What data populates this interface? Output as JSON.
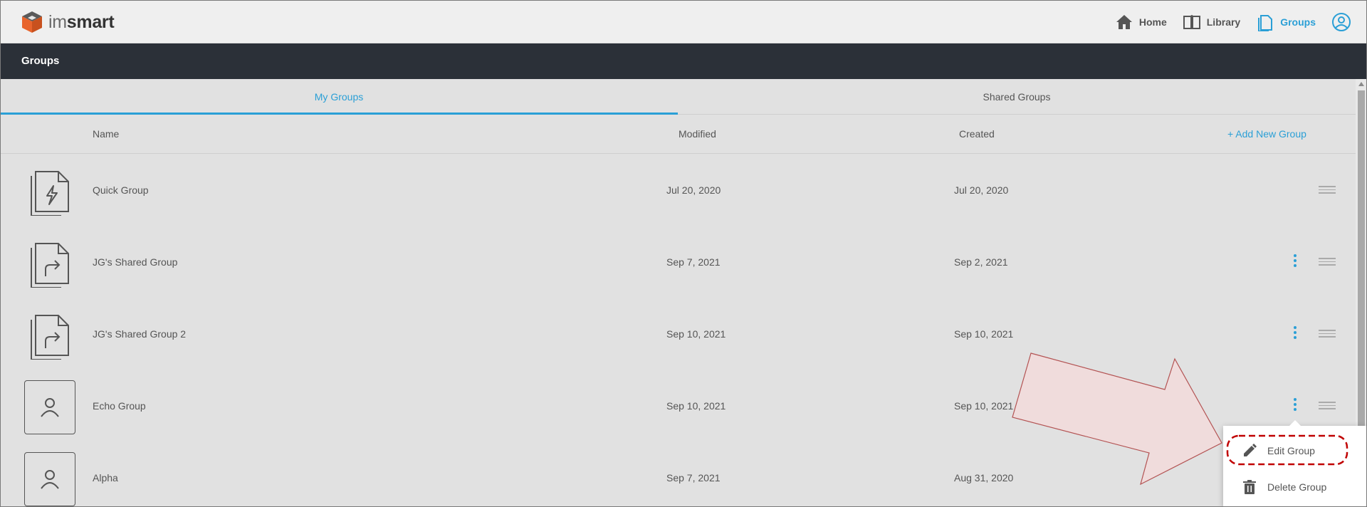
{
  "app": {
    "logo_text_light": "im",
    "logo_text_bold": "smart"
  },
  "nav": {
    "home": "Home",
    "library": "Library",
    "groups": "Groups",
    "user_icon": "user-circle-icon"
  },
  "page": {
    "title": "Groups"
  },
  "tabs": [
    {
      "label": "My Groups",
      "active": true
    },
    {
      "label": "Shared Groups",
      "active": false
    }
  ],
  "columns": {
    "name": "Name",
    "modified": "Modified",
    "created": "Created",
    "add_new": "+ Add New Group"
  },
  "groups": [
    {
      "name": "Quick Group",
      "modified": "Jul 20, 2020",
      "created": "Jul 20, 2020",
      "icon": "quick-group-icon",
      "has_menu": false
    },
    {
      "name": "JG's Shared Group",
      "modified": "Sep 7, 2021",
      "created": "Sep 2, 2021",
      "icon": "shared-group-icon",
      "has_menu": true
    },
    {
      "name": "JG's Shared Group 2",
      "modified": "Sep 10, 2021",
      "created": "Sep 10, 2021",
      "icon": "shared-group-icon",
      "has_menu": true
    },
    {
      "name": "Echo Group",
      "modified": "Sep 10, 2021",
      "created": "Sep 10, 2021",
      "icon": "person-icon",
      "has_menu": true
    },
    {
      "name": "Alpha",
      "modified": "Sep 7, 2021",
      "created": "Aug 31, 2020",
      "icon": "person-icon",
      "has_menu": true
    }
  ],
  "context_menu": {
    "edit": "Edit Group",
    "delete": "Delete Group"
  },
  "colors": {
    "accent": "#2a9fd6",
    "titlebar": "#2b3038",
    "annotation_red": "#c00000",
    "arrow_fill": "#f2dcdc"
  }
}
